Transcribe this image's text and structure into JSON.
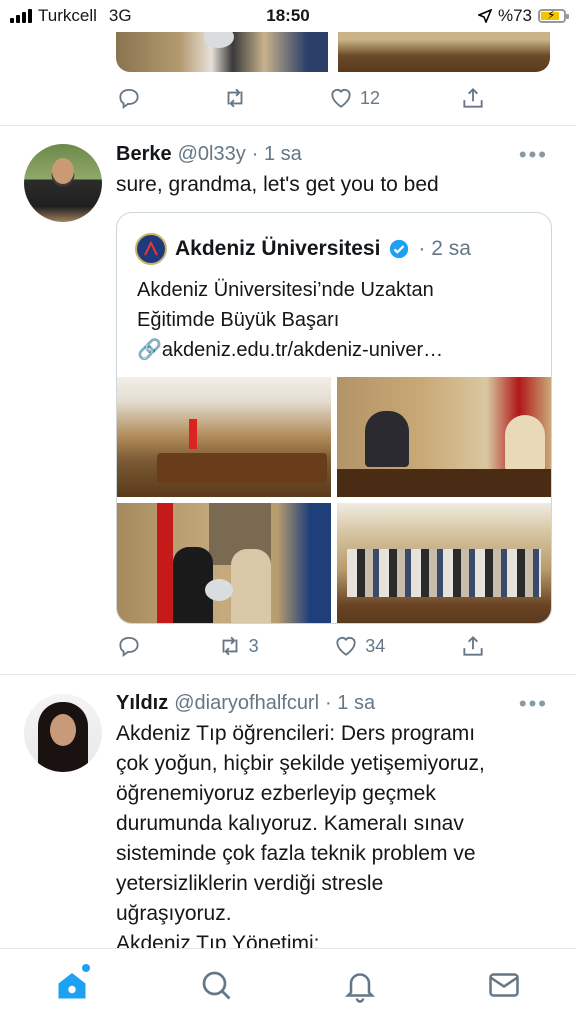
{
  "status_bar": {
    "carrier": "Turkcell",
    "network": "3G",
    "time": "18:50",
    "battery_text": "%73"
  },
  "top_tweet_actions": {
    "likes": "12"
  },
  "tweet1": {
    "name": "Berke",
    "handle": "@0l33y",
    "time": "· 1 sa",
    "text": "sure, grandma, let's get you to bed",
    "quoted": {
      "name": "Akdeniz Üniversitesi",
      "time": "· 2 sa",
      "text_line1": "Akdeniz Üniversitesi’nde Uzaktan",
      "text_line2": "Eğitimde Büyük Başarı",
      "link": "🔗akdeniz.edu.tr/akdeniz-univer…"
    },
    "retweets": "3",
    "likes": "34"
  },
  "tweet2": {
    "name": "Yıldız",
    "handle": "@diaryofhalfcurl",
    "time": "· 1 sa",
    "lines": [
      "Akdeniz Tıp öğrencileri: Ders programı",
      "çok yoğun, hiçbir şekilde yetişemiyoruz,",
      "öğrenemiyoruz ezberleyip geçmek",
      "durumunda kalıyoruz. Kameralı sınav",
      "sisteminde çok fazla teknik problem ve",
      "yetersizliklerin verdiği stresle",
      "uğraşıyoruz.",
      "Akdeniz Tıp Yönetimi:"
    ]
  },
  "more_label": "•••",
  "icons": {
    "reply": "reply-icon",
    "retweet": "retweet-icon",
    "like": "heart-icon",
    "share": "share-icon",
    "home": "home-icon",
    "search": "search-icon",
    "notifications": "bell-icon",
    "messages": "mail-icon"
  },
  "colors": {
    "accent": "#1da1f2",
    "muted": "#657786",
    "battery": "#f5c400"
  }
}
